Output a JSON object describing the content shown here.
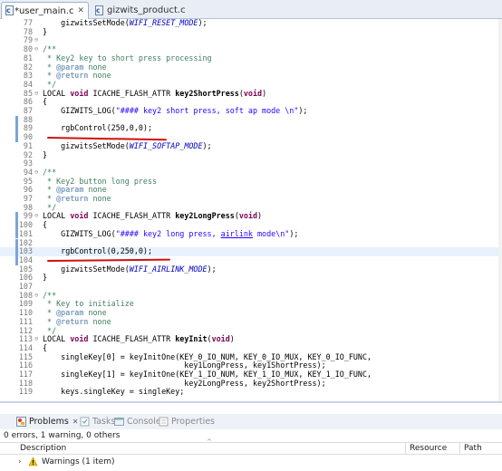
{
  "tabs": [
    {
      "label": "*user_main.c",
      "active": true
    },
    {
      "label": "gizwits_product.c",
      "active": false
    }
  ],
  "editor": {
    "lines": [
      {
        "n": "77",
        "html": "    gizwitsSetMode(<span class=\"it\">WIFI_RESET_MODE</span>);"
      },
      {
        "n": "78",
        "html": "}"
      },
      {
        "n": "79",
        "fold": "⊖",
        "html": ""
      },
      {
        "n": "80",
        "fold": "⊖",
        "html": "<span class=\"cm\">/**</span>"
      },
      {
        "n": "81",
        "html": "<span class=\"cm\"> * Key2 key to short press processing</span>"
      },
      {
        "n": "82",
        "html": "<span class=\"cm\"> * <span class=\"tag\">@param</span> none</span>"
      },
      {
        "n": "83",
        "html": "<span class=\"cm\"> * <span class=\"tag\">@return</span> none</span>"
      },
      {
        "n": "84",
        "html": "<span class=\"cm\"> */</span>"
      },
      {
        "n": "85",
        "fold": "⊖",
        "html": "LOCAL <span class=\"kw\">void</span> ICACHE_FLASH_ATTR <span class=\"bold\">key2ShortPress</span>(<span class=\"kw\">void</span>)"
      },
      {
        "n": "86",
        "html": "{"
      },
      {
        "n": "87",
        "html": "    GIZWITS_LOG(<span class=\"str\">\"#### key2 short press, soft ap mode \\n\"</span>);"
      },
      {
        "n": "88",
        "html": "",
        "marker": true
      },
      {
        "n": "89",
        "html": "    rgbControl(250,0,0);",
        "marker": true
      },
      {
        "n": "90",
        "html": "",
        "marker": true
      },
      {
        "n": "91",
        "html": "    gizwitsSetMode(<span class=\"it\">WIFI_SOFTAP_MODE</span>);"
      },
      {
        "n": "92",
        "html": "}"
      },
      {
        "n": "93",
        "html": ""
      },
      {
        "n": "94",
        "fold": "⊖",
        "html": "<span class=\"cm\">/**</span>"
      },
      {
        "n": "95",
        "html": "<span class=\"cm\"> * Key2 button long press</span>"
      },
      {
        "n": "96",
        "html": "<span class=\"cm\"> * <span class=\"tag\">@param</span> none</span>"
      },
      {
        "n": "97",
        "html": "<span class=\"cm\"> * <span class=\"tag\">@return</span> none</span>"
      },
      {
        "n": "98",
        "html": "<span class=\"cm\"> */</span>"
      },
      {
        "n": "99",
        "fold": "⊖",
        "html": "LOCAL <span class=\"kw\">void</span> ICACHE_FLASH_ATTR <span class=\"bold\">key2LongPress</span>(<span class=\"kw\">void</span>)",
        "marker": true
      },
      {
        "n": "100",
        "html": "{",
        "marker": true
      },
      {
        "n": "101",
        "html": "    GIZWITS_LOG(<span class=\"str\">\"#### key2 long press, <u>airlink</u> mode\\n\"</span>);",
        "marker": true
      },
      {
        "n": "102",
        "html": "",
        "marker": true
      },
      {
        "n": "103",
        "html": "    rgbControl(0,250,0);",
        "marker": true,
        "hl": true
      },
      {
        "n": "104",
        "html": "",
        "marker": true
      },
      {
        "n": "105",
        "html": "    gizwitsSetMode(<span class=\"it\">WIFI_AIRLINK_MODE</span>);"
      },
      {
        "n": "106",
        "html": "}"
      },
      {
        "n": "107",
        "html": ""
      },
      {
        "n": "108",
        "fold": "⊖",
        "html": "<span class=\"cm\">/**</span>"
      },
      {
        "n": "109",
        "html": "<span class=\"cm\"> * Key to initialize</span>"
      },
      {
        "n": "110",
        "html": "<span class=\"cm\"> * <span class=\"tag\">@param</span> none</span>"
      },
      {
        "n": "111",
        "html": "<span class=\"cm\"> * <span class=\"tag\">@return</span> none</span>"
      },
      {
        "n": "112",
        "html": "<span class=\"cm\"> */</span>"
      },
      {
        "n": "113",
        "fold": "⊖",
        "html": "LOCAL <span class=\"kw\">void</span> ICACHE_FLASH_ATTR <span class=\"bold\">keyInit</span>(<span class=\"kw\">void</span>)"
      },
      {
        "n": "114",
        "html": "{"
      },
      {
        "n": "115",
        "html": "    singleKey[0] = keyInitOne(KEY_0_IO_NUM, KEY_0_IO_MUX, KEY_0_IO_FUNC,"
      },
      {
        "n": "116",
        "html": "                               key1LongPress, key1ShortPress);"
      },
      {
        "n": "117",
        "html": "    singleKey[1] = keyInitOne(KEY_1_IO_NUM, KEY_1_IO_MUX, KEY_1_IO_FUNC,"
      },
      {
        "n": "118",
        "html": "                               key2LongPress, key2ShortPress);"
      },
      {
        "n": "119",
        "html": "    keys.singleKey = singleKey;"
      }
    ]
  },
  "panel": {
    "tabs": [
      {
        "label": "Problems",
        "active": true
      },
      {
        "label": "Tasks",
        "active": false
      },
      {
        "label": "Console",
        "active": false
      },
      {
        "label": "Properties",
        "active": false
      }
    ],
    "status": "0 errors, 1 warning, 0 others",
    "columns": {
      "description": "Description",
      "resource": "Resource",
      "path": "Path"
    },
    "rows": [
      {
        "label": "Warnings (1 item)"
      }
    ]
  },
  "colors": {
    "accent": "#2e5fb6",
    "keyword": "#7f0055",
    "comment": "#3f7f5f",
    "string": "#2a00ff",
    "constant": "#0000c0",
    "annotation": "#d01010"
  }
}
